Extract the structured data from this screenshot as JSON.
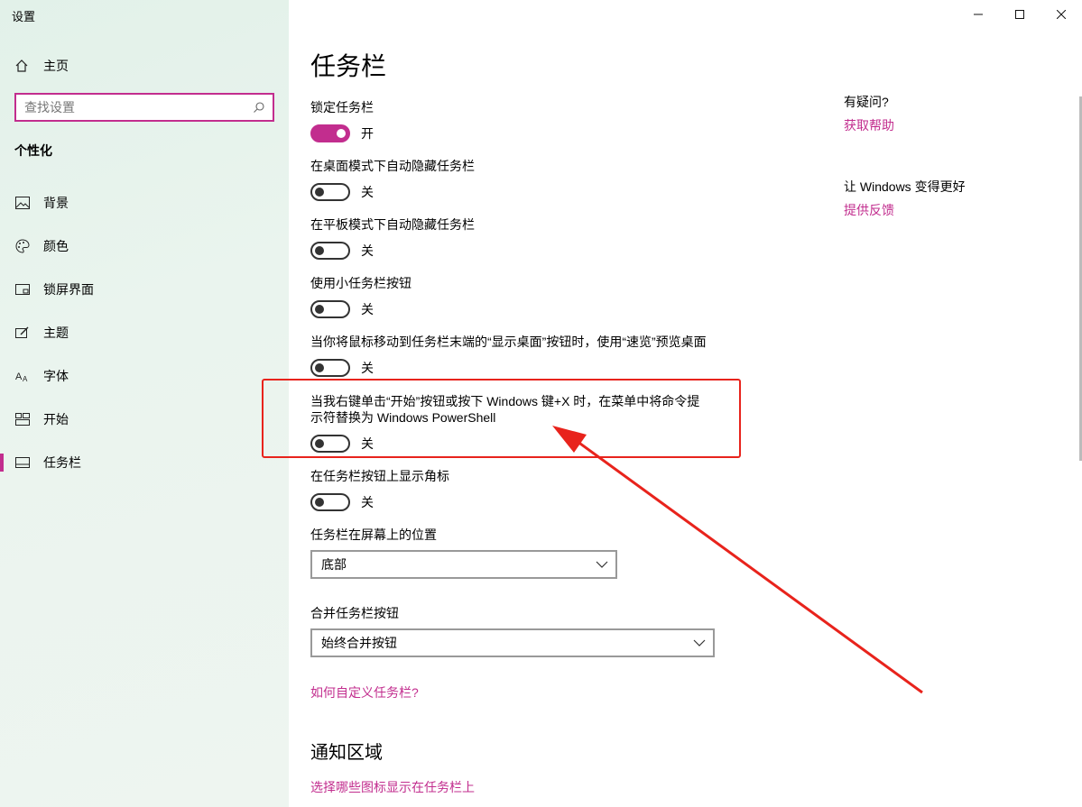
{
  "window": {
    "title": "设置"
  },
  "sidebar": {
    "home_label": "主页",
    "search_placeholder": "查找设置",
    "section_label": "个性化",
    "items": [
      {
        "label": "背景",
        "icon": "picture-icon"
      },
      {
        "label": "颜色",
        "icon": "palette-icon"
      },
      {
        "label": "锁屏界面",
        "icon": "lockscreen-icon"
      },
      {
        "label": "主题",
        "icon": "theme-icon"
      },
      {
        "label": "字体",
        "icon": "font-icon"
      },
      {
        "label": "开始",
        "icon": "start-icon"
      },
      {
        "label": "任务栏",
        "icon": "taskbar-icon",
        "active": true
      }
    ]
  },
  "main": {
    "title": "任务栏",
    "settings": [
      {
        "label": "锁定任务栏",
        "state": "开",
        "on": true
      },
      {
        "label": "在桌面模式下自动隐藏任务栏",
        "state": "关",
        "on": false
      },
      {
        "label": "在平板模式下自动隐藏任务栏",
        "state": "关",
        "on": false
      },
      {
        "label": "使用小任务栏按钮",
        "state": "关",
        "on": false
      },
      {
        "label": "当你将鼠标移动到任务栏末端的“显示桌面”按钮时，使用“速览”预览桌面",
        "state": "关",
        "on": false
      },
      {
        "label": "当我右键单击“开始”按钮或按下 Windows 键+X 时，在菜单中将命令提示符替换为 Windows PowerShell",
        "state": "关",
        "on": false
      },
      {
        "label": "在任务栏按钮上显示角标",
        "state": "关",
        "on": false
      }
    ],
    "position": {
      "label": "任务栏在屏幕上的位置",
      "value": "底部"
    },
    "combine": {
      "label": "合并任务栏按钮",
      "value": "始终合并按钮"
    },
    "customize_link": "如何自定义任务栏?",
    "notification_title": "通知区域",
    "notification_link": "选择哪些图标显示在任务栏上"
  },
  "right_panel": {
    "help_title": "有疑问?",
    "help_link": "获取帮助",
    "feedback_title": "让 Windows 变得更好",
    "feedback_link": "提供反馈"
  },
  "colors": {
    "accent": "#c22d8e",
    "annotation": "#e8231c"
  }
}
